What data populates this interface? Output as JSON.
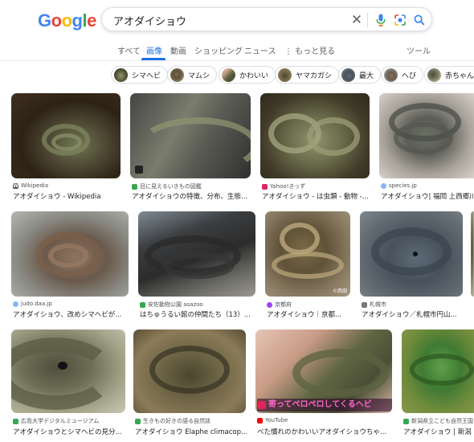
{
  "logo": {
    "letters": [
      "G",
      "o",
      "o",
      "g",
      "l",
      "e"
    ],
    "colors": [
      "#4285f4",
      "#ea4335",
      "#fbbc05",
      "#4285f4",
      "#34a853",
      "#ea4335"
    ]
  },
  "search": {
    "query": "アオダイショウ"
  },
  "icons": {
    "clear": "close-icon",
    "mic": "mic-icon",
    "lens": "lens-icon",
    "search": "search-icon"
  },
  "tabs": [
    {
      "label": "すべて",
      "active": false
    },
    {
      "label": "画像",
      "active": true
    },
    {
      "label": "動画",
      "active": false
    },
    {
      "label": "ショッピング",
      "active": false
    },
    {
      "label": "ニュース",
      "active": false
    },
    {
      "label": "⋮ もっと見る",
      "active": false
    },
    {
      "label": "ツール",
      "active": false
    }
  ],
  "chips": [
    "シマヘビ",
    "マムシ",
    "かわいい",
    "ヤマカガシ",
    "最大",
    "へび",
    "赤ちゃん"
  ],
  "results": [
    {
      "source": "Wikipedia",
      "title": "アオダイショウ - Wikipedia"
    },
    {
      "source": "目に見えるいきもの図鑑",
      "title": "アオダイショウの特徴、分布、生態..."
    },
    {
      "source": "Yahoo!きっず",
      "title": "アオダイショウ - は虫類 - 動物 -..."
    },
    {
      "source": "species.jp",
      "title": "アオダイショウ| 福岡 上西郷川"
    },
    {
      "source": "judo.daa.jp",
      "title": "アオダイショウ、改めシマヘビが..."
    },
    {
      "source": "安佐動物公園 asazoo",
      "title": "はちゅうるい館の仲間たち（13）..."
    },
    {
      "source": "京都府",
      "title": "アオダイショウ｜京都..."
    },
    {
      "source": "札幌市",
      "title": "アオダイショウ／札幌市円山..."
    },
    {
      "source": "広島大学デジタルミュージアム",
      "title": "アオダイショウとシマヘビの見分..."
    },
    {
      "source": "生きもの好きの語る自然誌",
      "title": "アオダイショウ Elaphe climacop..."
    },
    {
      "source": "YouTube",
      "title": "べた慣れのかわいいアオダイショウちゃ..."
    },
    {
      "source": "新潟県立こども自然王国",
      "title": "アオダイショウ | 新潟"
    }
  ],
  "overlays": {
    "video_caption": "寄ってペロペロしてくるヘビ",
    "watermark": "©西田"
  },
  "accent_color": "#1a73e8"
}
